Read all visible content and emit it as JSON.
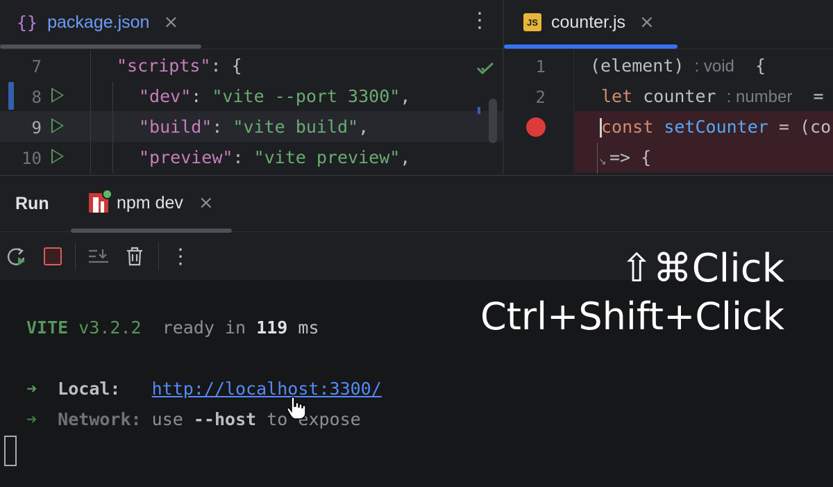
{
  "left_editor": {
    "tab": {
      "icon": "json-braces-icon",
      "title": "package.json",
      "close": "×"
    },
    "more_menu": "⋮",
    "lines": [
      {
        "num": "7",
        "code": [
          [
            "\"scripts\"",
            "k-str"
          ],
          [
            ": {",
            "k-pun"
          ]
        ],
        "indent": 0,
        "run": false
      },
      {
        "num": "8",
        "code": [
          [
            "\"dev\"",
            "k-str"
          ],
          [
            ": ",
            "k-pun"
          ],
          [
            "\"vite --port 3300\"",
            "k-val"
          ],
          [
            ",",
            "k-pun"
          ]
        ],
        "indent": 1,
        "run": true
      },
      {
        "num": "9",
        "code": [
          [
            "\"build\"",
            "k-str"
          ],
          [
            ": ",
            "k-pun"
          ],
          [
            "\"vite build\"",
            "k-val"
          ],
          [
            ",",
            "k-pun"
          ]
        ],
        "indent": 1,
        "run": true
      },
      {
        "num": "10",
        "code": [
          [
            "\"preview\"",
            "k-str"
          ],
          [
            ": ",
            "k-pun"
          ],
          [
            "\"vite preview\"",
            "k-val"
          ],
          [
            ",",
            "k-pun"
          ]
        ],
        "indent": 1,
        "run": true
      }
    ]
  },
  "right_editor": {
    "tab": {
      "icon": "JS",
      "title": "counter.js",
      "close": "×"
    },
    "lines": [
      {
        "num": "1"
      },
      {
        "num": "2"
      },
      {
        "num": ""
      },
      {
        "num": ""
      }
    ],
    "line1": {
      "code": "(element)",
      "hint": ": void",
      "tail": "{"
    },
    "line2": {
      "kw": "let",
      "name": "counter",
      "hint": ": number",
      "tail": "="
    },
    "line3": {
      "kw": "const",
      "fn": "setCounter",
      "tail": " = (co"
    },
    "line4": {
      "code": "=> {"
    }
  },
  "run_panel": {
    "title": "Run",
    "tab": {
      "title": "npm dev",
      "close": "×"
    },
    "toolbar": {
      "rerun": "rerun-icon",
      "stop": "stop-icon",
      "scroll_end": "scroll-to-end-icon",
      "clear": "trash-icon",
      "more": "⋮"
    },
    "console": {
      "vite_name": "VITE",
      "vite_version": "v3.2.2",
      "ready_prefix": "ready in",
      "ready_ms": "119",
      "ready_unit": "ms",
      "arrow": "➜",
      "local_label": "Local:",
      "local_url": "http://localhost:3300/",
      "network_label": "Network:",
      "network_use": "use",
      "network_flag": "--host",
      "network_rest": "to expose"
    }
  },
  "overlay": {
    "mac_shortcut": "⇧⌘Click",
    "win_shortcut": "Ctrl+Shift+Click"
  }
}
